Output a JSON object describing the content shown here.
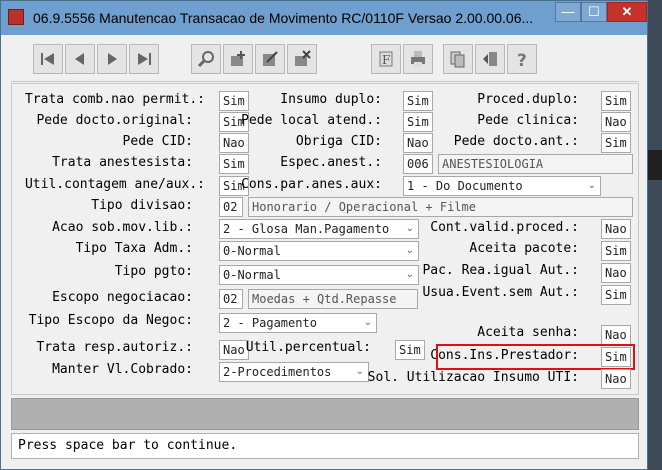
{
  "window": {
    "title": "06.9.5556 Manutencao  Transacao de Movimento RC/0110F Versao 2.00.00.06...",
    "min_label": "—",
    "max_label": "☐",
    "close_label": "✕"
  },
  "toolbar": {
    "buttons": [
      "first-icon",
      "prev-icon",
      "next-icon",
      "last-icon",
      "search-icon",
      "add-icon",
      "edit-icon",
      "delete-icon",
      "filter-icon",
      "print-icon",
      "copy-icon",
      "exit-icon",
      "help-icon"
    ]
  },
  "form": {
    "fields": {
      "trata_comb": {
        "label": "Trata comb.nao permit.:",
        "value": "Sim"
      },
      "insumo_duplo": {
        "label": "Insumo duplo:",
        "value": "Sim"
      },
      "proced_duplo": {
        "label": "Proced.duplo:",
        "value": "Sim"
      },
      "pede_docto_original": {
        "label": "Pede docto.original:",
        "value": "Sim"
      },
      "pede_local_atend": {
        "label": "Pede local atend.:",
        "value": "Sim"
      },
      "pede_clinica": {
        "label": "Pede clinica:",
        "value": "Nao"
      },
      "pede_cid": {
        "label": "Pede CID:",
        "value": "Nao"
      },
      "obriga_cid": {
        "label": "Obriga CID:",
        "value": "Nao"
      },
      "pede_docto_ant": {
        "label": "Pede docto.ant.:",
        "value": "Sim"
      },
      "trata_anestesista": {
        "label": "Trata anestesista:",
        "value": "Sim"
      },
      "espec_anest": {
        "label": "Espec.anest.:",
        "code": "006",
        "desc": "ANESTESIOLOGIA"
      },
      "util_contagem": {
        "label": "Util.contagem ane/aux.:",
        "value": "Sim"
      },
      "cons_par_anes_aux": {
        "label": "Cons.par.anes.aux:",
        "value": "1 - Do Documento"
      },
      "tipo_divisao": {
        "label": "Tipo divisao:",
        "code": "02",
        "desc": "Honorario / Operacional + Filme"
      },
      "acao_sob_mov_lib": {
        "label": "Acao sob.mov.lib.:",
        "value": "2 - Glosa Man.Pagamento"
      },
      "cont_valid_proced": {
        "label": "Cont.valid.proced.:",
        "value": "Nao"
      },
      "tipo_taxa_adm": {
        "label": "Tipo Taxa Adm.:",
        "value": "0-Normal"
      },
      "aceita_pacote": {
        "label": "Aceita pacote:",
        "value": "Sim"
      },
      "tipo_pgto": {
        "label": "Tipo pgto:",
        "value": "0-Normal"
      },
      "pac_rea_igual": {
        "label": "Pac. Rea.igual Aut.:",
        "value": "Nao"
      },
      "escopo_negociacao": {
        "label": "Escopo negociacao:",
        "code": "02",
        "desc": "Moedas + Qtd.Repasse"
      },
      "usua_event_sem_aut": {
        "label": "Usua.Event.sem Aut.:",
        "value": "Sim"
      },
      "tipo_escopo_negoc": {
        "label": "Tipo Escopo da Negoc:",
        "value": "2 - Pagamento"
      },
      "aceita_senha": {
        "label": "Aceita senha:",
        "value": "Nao"
      },
      "trata_resp_autoriz": {
        "label": "Trata resp.autoriz.:",
        "value": "Nao"
      },
      "util_percentual": {
        "label": "Util.percentual:",
        "value": "Sim"
      },
      "cons_ins_prestador": {
        "label": "Cons.Ins.Prestador:",
        "value": "Sim"
      },
      "manter_vl_cobrado": {
        "label": "Manter Vl.Cobrado:",
        "value": "2-Procedimentos"
      },
      "sol_utilizacao_insumo": {
        "label": "Sol. Utilizacao Insumo UTI:",
        "value": "Nao"
      }
    }
  },
  "status": {
    "message": "Press space bar to continue."
  },
  "colors": {
    "titlebar": "#6f9fce",
    "highlight": "#e01010",
    "close": "#c7312b"
  }
}
